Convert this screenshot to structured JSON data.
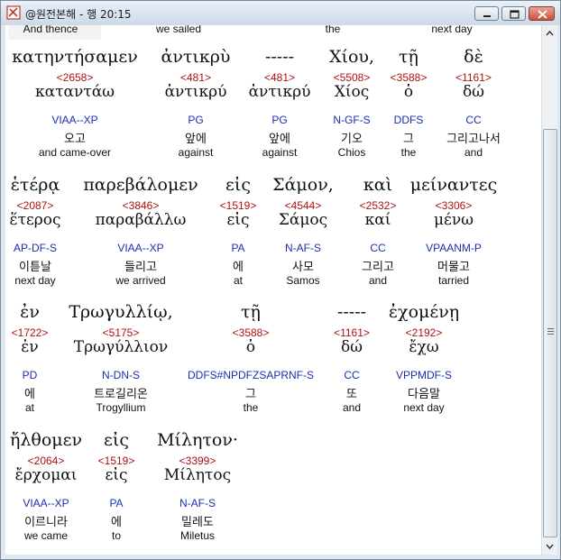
{
  "window": {
    "title": "@원전본해 - 행 20:15",
    "buttons": [
      "minimize-icon",
      "maximize-icon",
      "close-icon"
    ]
  },
  "top_strip": [
    "And thence",
    "we sailed",
    "the",
    "next day"
  ],
  "verse": [
    {
      "words": [
        {
          "greek": "κατηντήσαμεν",
          "num": "<2658>",
          "lemma": "καταντάω",
          "parse": "VIAA--XP",
          "korean": "오고",
          "english": "and came-over"
        },
        {
          "greek": "ἀντικρὺ",
          "num": "<481>",
          "lemma": "ἀντικρύ",
          "parse": "PG",
          "korean": "앞에",
          "english": "against"
        },
        {
          "greek": "-----",
          "num": "<481>",
          "lemma": "ἀντικρύ",
          "parse": "PG",
          "korean": "앞에",
          "english": "against"
        },
        {
          "greek": "Χίου,",
          "num": "<5508>",
          "lemma": "Χίος",
          "parse": "N-GF-S",
          "korean": "기오",
          "english": "Chios"
        },
        {
          "greek": "τῇ",
          "num": "<3588>",
          "lemma": "ὁ",
          "parse": "DDFS",
          "korean": "그",
          "english": "the"
        },
        {
          "greek": "δὲ",
          "num": "<1161>",
          "lemma": "δώ",
          "parse": "CC",
          "korean": "그리고나서",
          "english": "and"
        }
      ]
    },
    {
      "words": [
        {
          "greek": "ἑτέρᾳ",
          "num": "<2087>",
          "lemma": "ἕτερος",
          "parse": "AP-DF-S",
          "korean": "이튿날",
          "english": "next day"
        },
        {
          "greek": "παρεβάλομεν",
          "num": "<3846>",
          "lemma": "παραβάλλω",
          "parse": "VIAA--XP",
          "korean": "들리고",
          "english": "we arrived"
        },
        {
          "greek": "εἰς",
          "num": "<1519>",
          "lemma": "εἰς",
          "parse": "PA",
          "korean": "에",
          "english": "at"
        },
        {
          "greek": "Σάμον,",
          "num": "<4544>",
          "lemma": "Σάμος",
          "parse": "N-AF-S",
          "korean": "사모",
          "english": "Samos"
        },
        {
          "greek": "καὶ",
          "num": "<2532>",
          "lemma": "καί",
          "parse": "CC",
          "korean": "그리고",
          "english": "and"
        },
        {
          "greek": "μείναντες",
          "num": "<3306>",
          "lemma": "μένω",
          "parse": "VPAANM-P",
          "korean": "머물고",
          "english": "tarried"
        }
      ]
    },
    {
      "words": [
        {
          "greek": "ἐν",
          "num": "<1722>",
          "lemma": "ἐν",
          "parse": "PD",
          "korean": "에",
          "english": "at"
        },
        {
          "greek": "Τρωγυλλίῳ,",
          "num": "<5175>",
          "lemma": "Τρωγύλλιον",
          "parse": "N-DN-S",
          "korean": "트로길리온",
          "english": "Trogyllium"
        },
        {
          "greek": "τῇ",
          "num": "<3588>",
          "lemma": "ὁ",
          "parse": "DDFS#NPDFZSAPRNF-S",
          "korean": "그",
          "english": "the"
        },
        {
          "greek": "-----",
          "num": "<1161>",
          "lemma": "δώ",
          "parse": "CC",
          "korean": "또",
          "english": "and"
        },
        {
          "greek": "ἐχομένῃ",
          "num": "<2192>",
          "lemma": "ἔχω",
          "parse": "VPPMDF-S",
          "korean": "다음말",
          "english": "next day"
        }
      ]
    },
    {
      "words": [
        {
          "greek": "ἤλθομεν",
          "num": "<2064>",
          "lemma": "ἔρχομαι",
          "parse": "VIAA--XP",
          "korean": "이르니라",
          "english": "we came"
        },
        {
          "greek": "εἰς",
          "num": "<1519>",
          "lemma": "εἰς",
          "parse": "PA",
          "korean": "에",
          "english": "to"
        },
        {
          "greek": "Μίλητον·",
          "num": "<3399>",
          "lemma": "Μίλητος",
          "parse": "N-AF-S",
          "korean": "밀레도",
          "english": "Miletus"
        }
      ]
    }
  ]
}
